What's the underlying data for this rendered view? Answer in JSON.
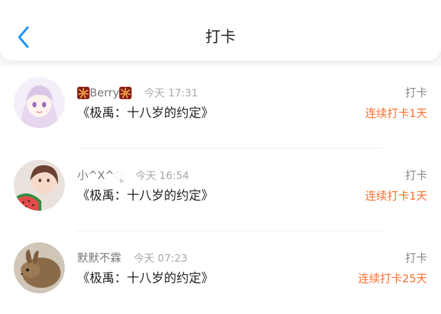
{
  "header": {
    "title": "打卡",
    "back_icon": "chevron-left-icon",
    "accent_color": "#1890ff"
  },
  "checkins": [
    {
      "username": "Berry",
      "username_decor_icon": "fireworks-icon",
      "time": "今天 17:31",
      "book": "《极禹：十八岁的约定》",
      "action": "打卡",
      "streak": "连续打卡1天"
    },
    {
      "username": "小^X^ୃ",
      "time": "今天 16:54",
      "book": "《极禹：十八岁的约定》",
      "action": "打卡",
      "streak": "连续打卡1天"
    },
    {
      "username": "默默不霖",
      "time": "今天 07:23",
      "book": "《极禹：十八岁的约定》",
      "action": "打卡",
      "streak": "连续打卡25天"
    }
  ],
  "colors": {
    "streak": "#ff6e2e",
    "secondary_text": "#888888",
    "primary_text": "#222222"
  }
}
